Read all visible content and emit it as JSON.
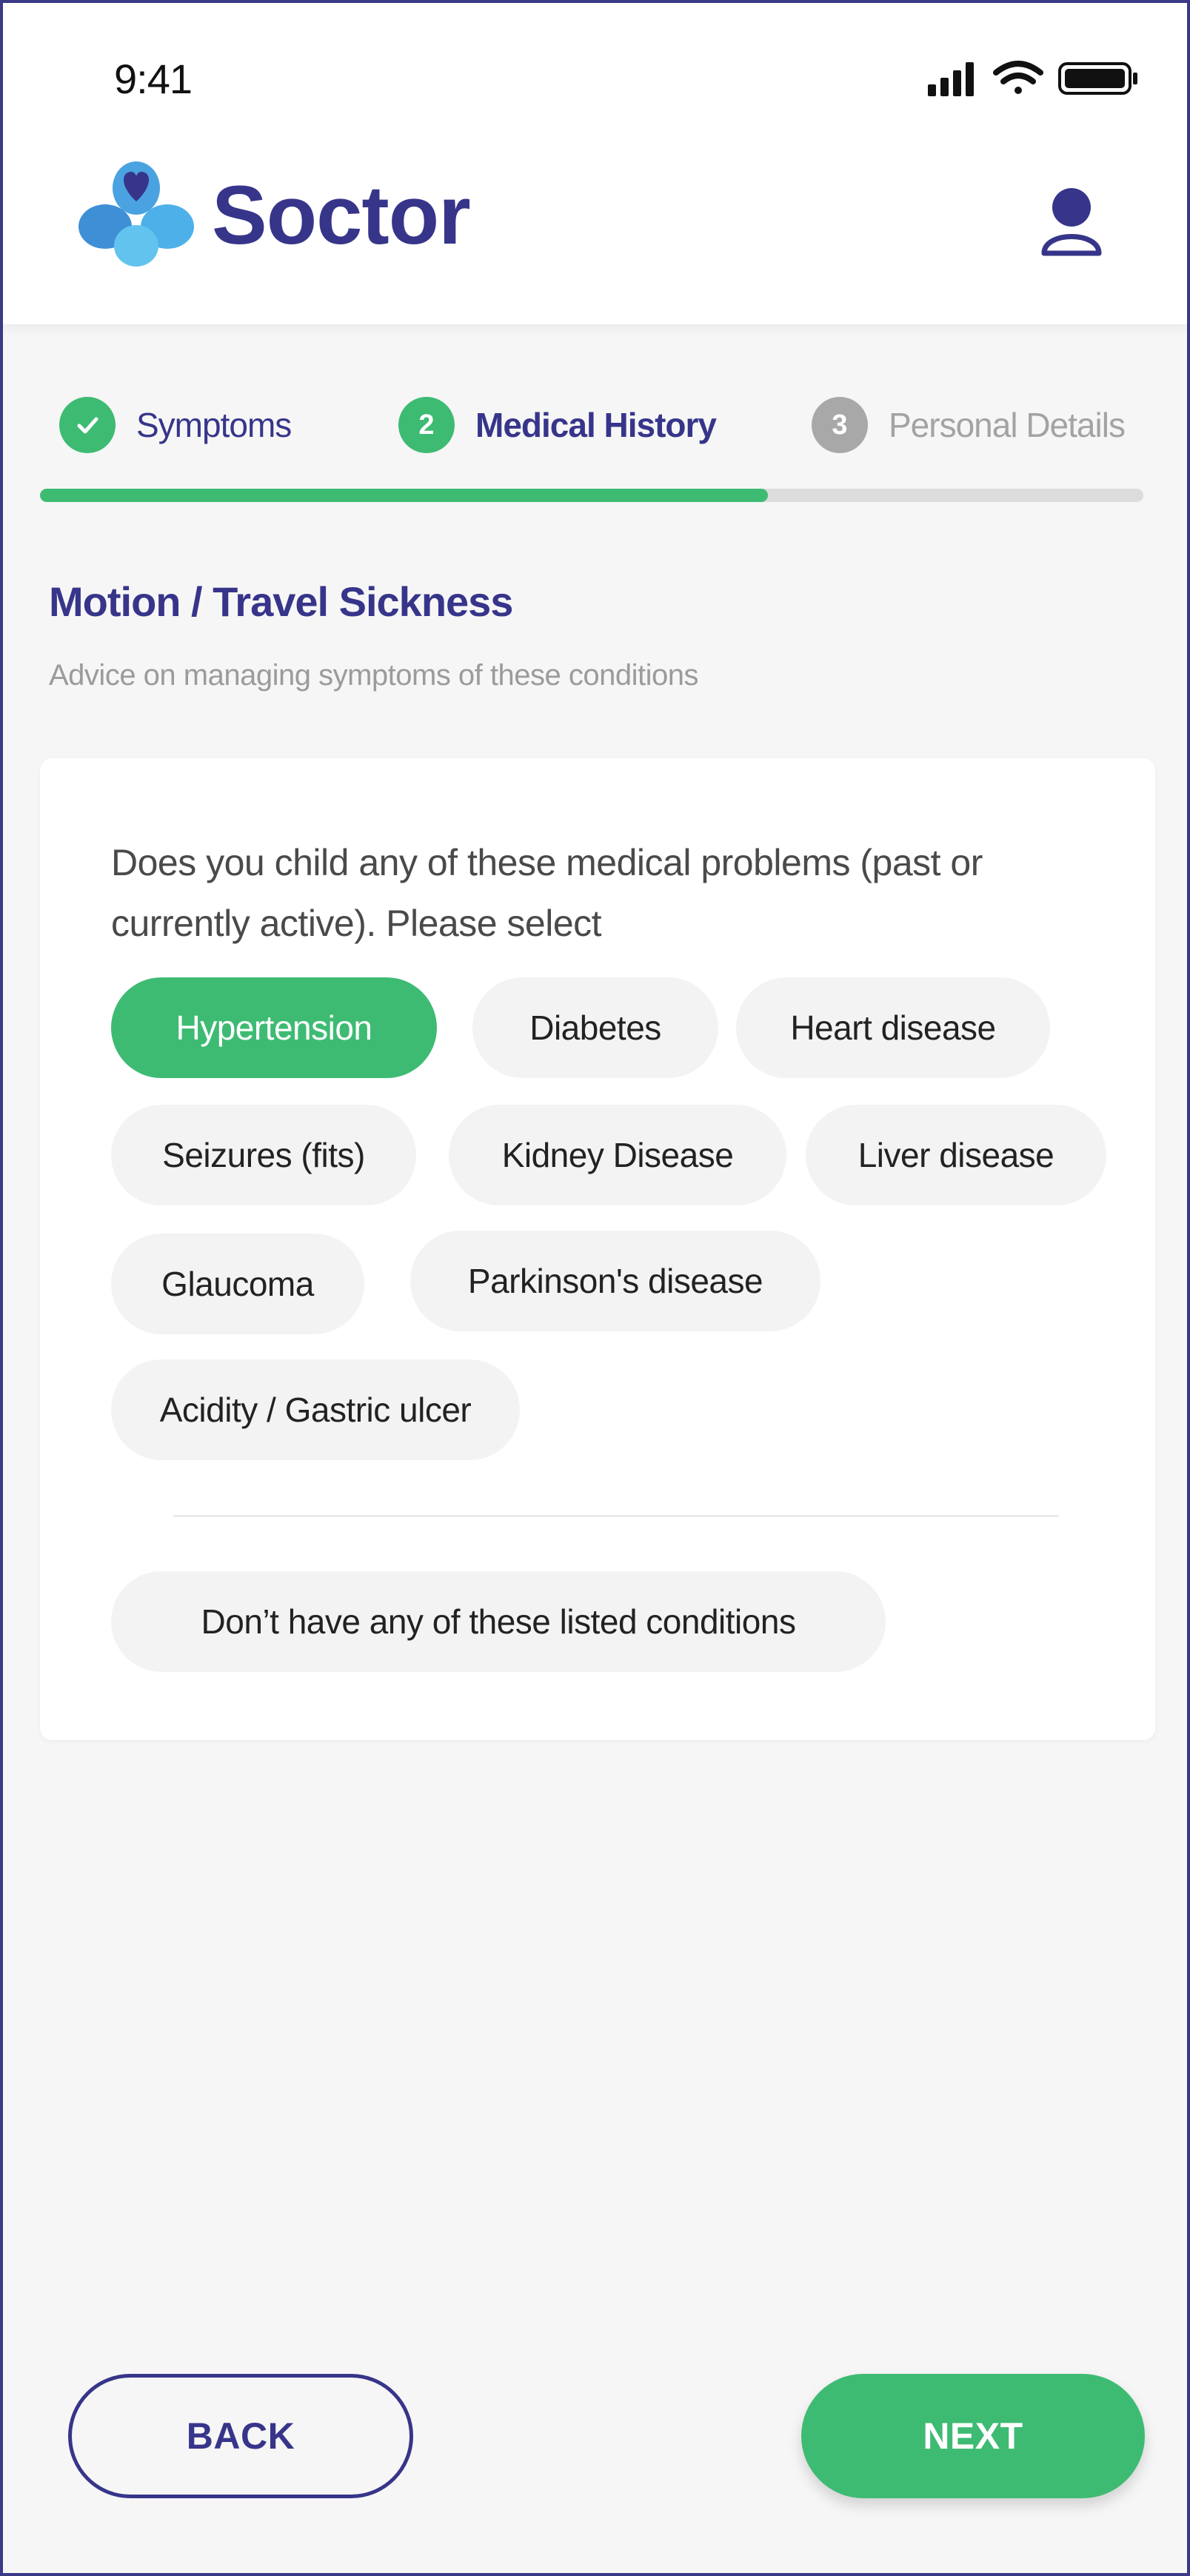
{
  "status_bar": {
    "time": "9:41"
  },
  "app": {
    "name": "Soctor"
  },
  "colors": {
    "brand": "#37358a",
    "accent": "#3ebb73",
    "pending": "#a8a8a8"
  },
  "steps": [
    {
      "number": "",
      "label": "Symptoms",
      "state": "done",
      "icon": "check-icon"
    },
    {
      "number": "2",
      "label": "Medical History",
      "state": "active"
    },
    {
      "number": "3",
      "label": "Personal Details",
      "state": "pending"
    }
  ],
  "progress": {
    "percent": 66
  },
  "page": {
    "title": "Motion / Travel Sickness",
    "subtitle": "Advice on managing symptoms of these conditions"
  },
  "question": {
    "line1": "Does you child any of these medical problems (past or",
    "line2": "currently active). Please select"
  },
  "conditions": [
    {
      "label": "Hypertension",
      "selected": true
    },
    {
      "label": "Diabetes",
      "selected": false
    },
    {
      "label": "Heart disease",
      "selected": false
    },
    {
      "label": "Seizures (fits)",
      "selected": false
    },
    {
      "label": "Kidney Disease",
      "selected": false
    },
    {
      "label": "Liver disease",
      "selected": false
    },
    {
      "label": "Glaucoma",
      "selected": false
    },
    {
      "label": "Parkinson's disease",
      "selected": false
    },
    {
      "label": "Acidity / Gastric ulcer",
      "selected": false
    }
  ],
  "none_option": {
    "label": "Don’t have any of these listed conditions"
  },
  "buttons": {
    "back": "BACK",
    "next": "NEXT"
  }
}
